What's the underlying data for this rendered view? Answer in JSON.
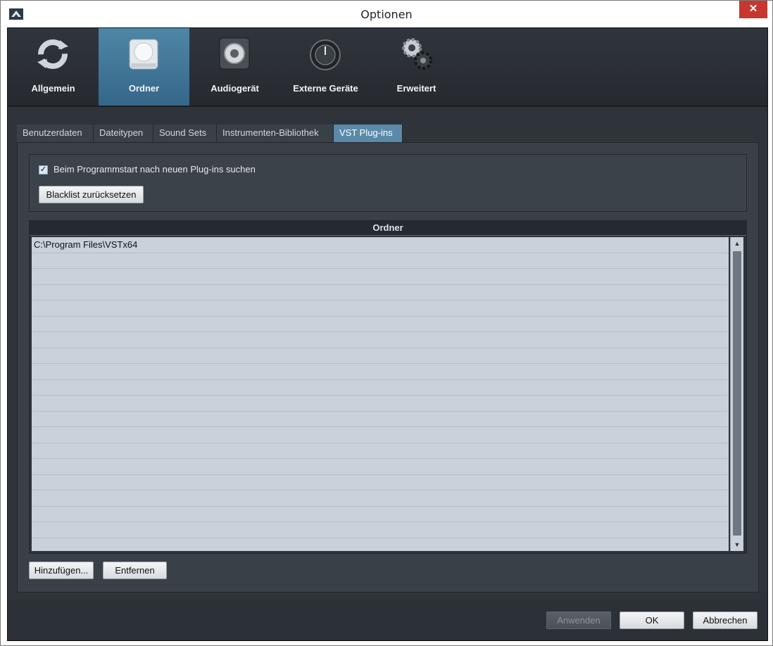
{
  "window": {
    "title": "Optionen",
    "close_label": "✕"
  },
  "nav": {
    "items": [
      {
        "label": "Allgemein",
        "icon": "refresh-icon"
      },
      {
        "label": "Ordner",
        "icon": "drive-icon",
        "active": true
      },
      {
        "label": "Audiogerät",
        "icon": "speaker-icon"
      },
      {
        "label": "Externe Geräte",
        "icon": "knob-icon"
      },
      {
        "label": "Erweitert",
        "icon": "gears-icon"
      }
    ]
  },
  "tabs": [
    "Benutzerdaten",
    "Dateitypen",
    "Sound Sets",
    "Instrumenten-Bibliothek",
    "VST Plug-ins"
  ],
  "active_tab": "VST Plug-ins",
  "options": {
    "scan_checkbox_label": "Beim Programmstart nach neuen Plug-ins suchen",
    "scan_checked": true,
    "blacklist_button": "Blacklist zurücksetzen"
  },
  "table": {
    "header": "Ordner",
    "rows": [
      "C:\\Program Files\\VSTx64"
    ]
  },
  "buttons": {
    "add": "Hinzufügen...",
    "remove": "Entfernen",
    "apply": "Anwenden",
    "ok": "OK",
    "cancel": "Abbrechen"
  },
  "colors": {
    "accent": "#4e86a5",
    "close": "#c7372f"
  }
}
